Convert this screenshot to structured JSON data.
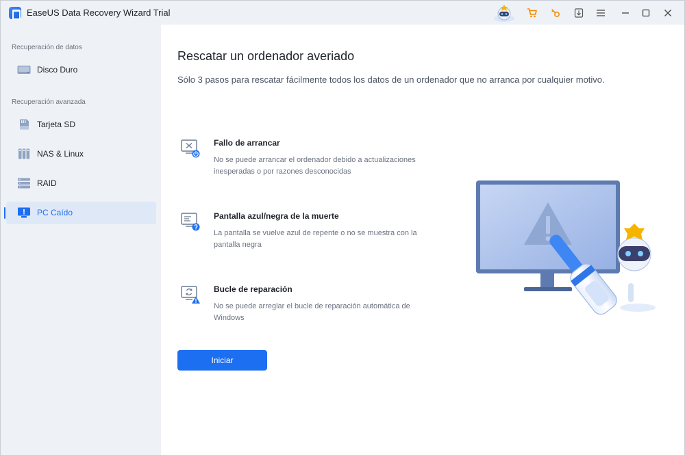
{
  "window": {
    "title": "EaseUS Data Recovery Wizard Trial"
  },
  "toolbar": {
    "icons": [
      "mascot-icon",
      "cart-icon",
      "key-icon",
      "download-icon",
      "menu-icon",
      "minimize-icon",
      "maximize-icon",
      "close-icon"
    ]
  },
  "sidebar": {
    "section_1": "Recuperación de datos",
    "section_2": "Recuperación avanzada",
    "items": [
      {
        "label": "Disco Duro",
        "icon": "hard-drive-icon"
      },
      {
        "label": "Tarjeta SD",
        "icon": "sd-card-icon"
      },
      {
        "label": "NAS & Linux",
        "icon": "nas-icon"
      },
      {
        "label": "RAID",
        "icon": "raid-icon"
      },
      {
        "label": "PC Caído",
        "icon": "crashed-pc-icon",
        "active": true
      }
    ]
  },
  "main": {
    "title": "Rescatar un ordenador averiado",
    "subtitle": "Sólo 3 pasos para rescatar fácilmente todos los datos de un ordenador que no arranca por cualquier motivo.",
    "features": [
      {
        "title": "Fallo de arrancar",
        "desc": "No se puede arrancar el ordenador debido a actualizaciones inesperadas o por razones desconocidas",
        "icon": "boot-failure-icon"
      },
      {
        "title": "Pantalla azul/negra de la muerte",
        "desc": "La pantalla se vuelve azul de repente o no se muestra con la pantalla negra",
        "icon": "blue-screen-icon"
      },
      {
        "title": "Bucle de reparación",
        "desc": "No se puede arreglar el bucle de reparación automática de Windows",
        "icon": "repair-loop-icon"
      }
    ],
    "start_button": "Iniciar"
  },
  "colors": {
    "accent": "#1d6ff2",
    "sidebar_bg": "#eef1f5",
    "active_bg": "#dfe8f7"
  }
}
